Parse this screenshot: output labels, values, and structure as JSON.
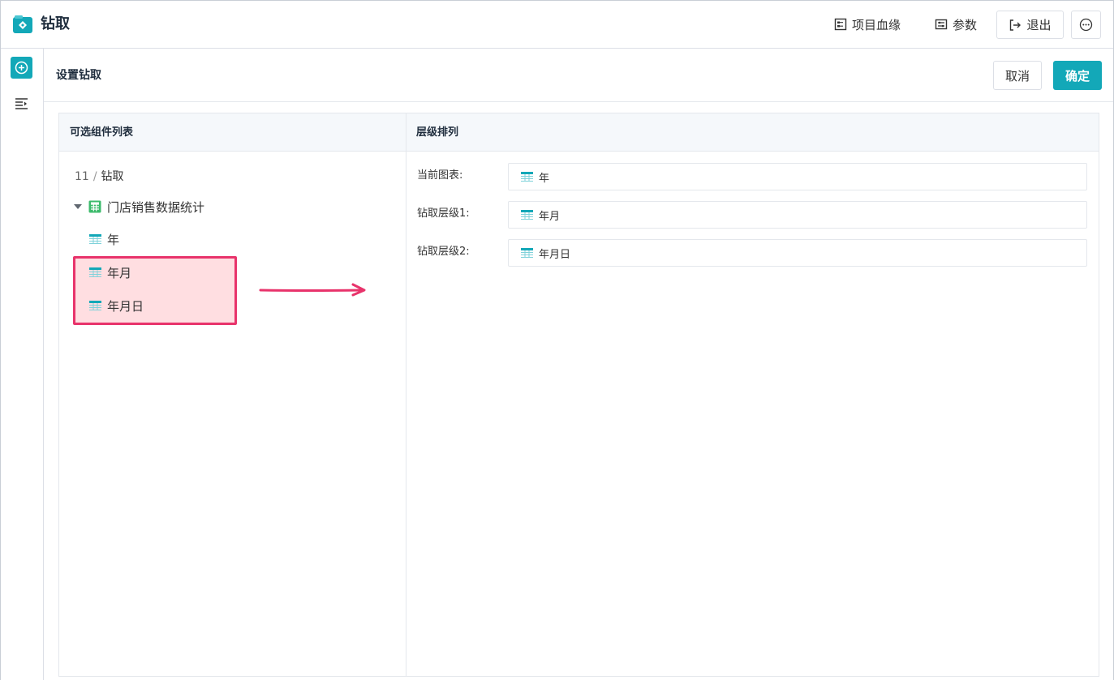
{
  "app": {
    "title": "钻取"
  },
  "toolbar": {
    "lineage_label": "项目血缘",
    "params_label": "参数",
    "exit_label": "退出"
  },
  "content": {
    "title": "设置钻取",
    "cancel_label": "取消",
    "confirm_label": "确定"
  },
  "left_panel": {
    "header": "可选组件列表",
    "breadcrumb": {
      "number": "11",
      "separator": "/",
      "name": "钻取"
    },
    "tree": {
      "root_label": "门店销售数据统计",
      "items": [
        {
          "label": "年"
        },
        {
          "label": "年月"
        },
        {
          "label": "年月日"
        }
      ]
    }
  },
  "right_panel": {
    "header": "层级排列",
    "levels": [
      {
        "label": "当前图表:",
        "value": "年"
      },
      {
        "label": "钻取层级1:",
        "value": "年月"
      },
      {
        "label": "钻取层级2:",
        "value": "年月日"
      }
    ]
  },
  "colors": {
    "accent": "#13a8b8",
    "highlight_border": "#e8336b",
    "highlight_fill": "#ffd9dc",
    "table_icon": "#13a8b8",
    "dataset_icon": "#3dbb6c"
  },
  "icons": {
    "app_logo": "drill-app-icon",
    "lineage": "lineage-icon",
    "params": "params-icon",
    "exit": "exit-icon",
    "more": "more-icon",
    "add": "add-circle-icon",
    "list": "list-indent-icon",
    "dataset": "dataset-table-icon",
    "field": "table-icon"
  }
}
